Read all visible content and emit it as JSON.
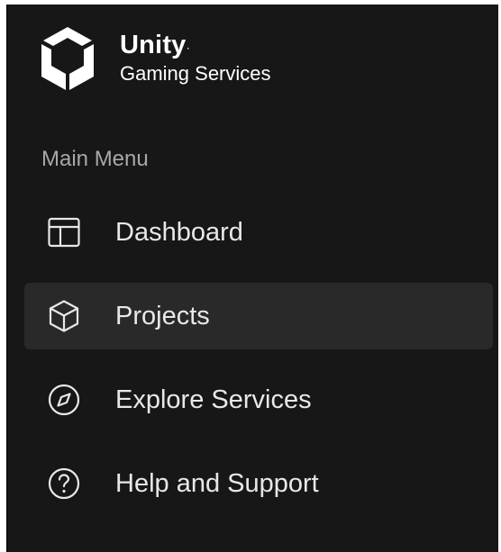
{
  "brand": {
    "name": "Unity",
    "trademark": "·",
    "subtitle": "Gaming Services",
    "logo_icon": "unity-cube-logo"
  },
  "sidebar": {
    "section_label": "Main Menu",
    "items": [
      {
        "label": "Dashboard",
        "icon": "dashboard-layout-icon",
        "active": false
      },
      {
        "label": "Projects",
        "icon": "cube-icon",
        "active": true
      },
      {
        "label": "Explore Services",
        "icon": "compass-icon",
        "active": false
      },
      {
        "label": "Help and Support",
        "icon": "question-circle-icon",
        "active": false
      }
    ]
  },
  "colors": {
    "sidebar_background": "#171717",
    "active_item_background": "#292929",
    "text_primary": "#e8e8e8",
    "text_muted": "#a8a8a8"
  }
}
